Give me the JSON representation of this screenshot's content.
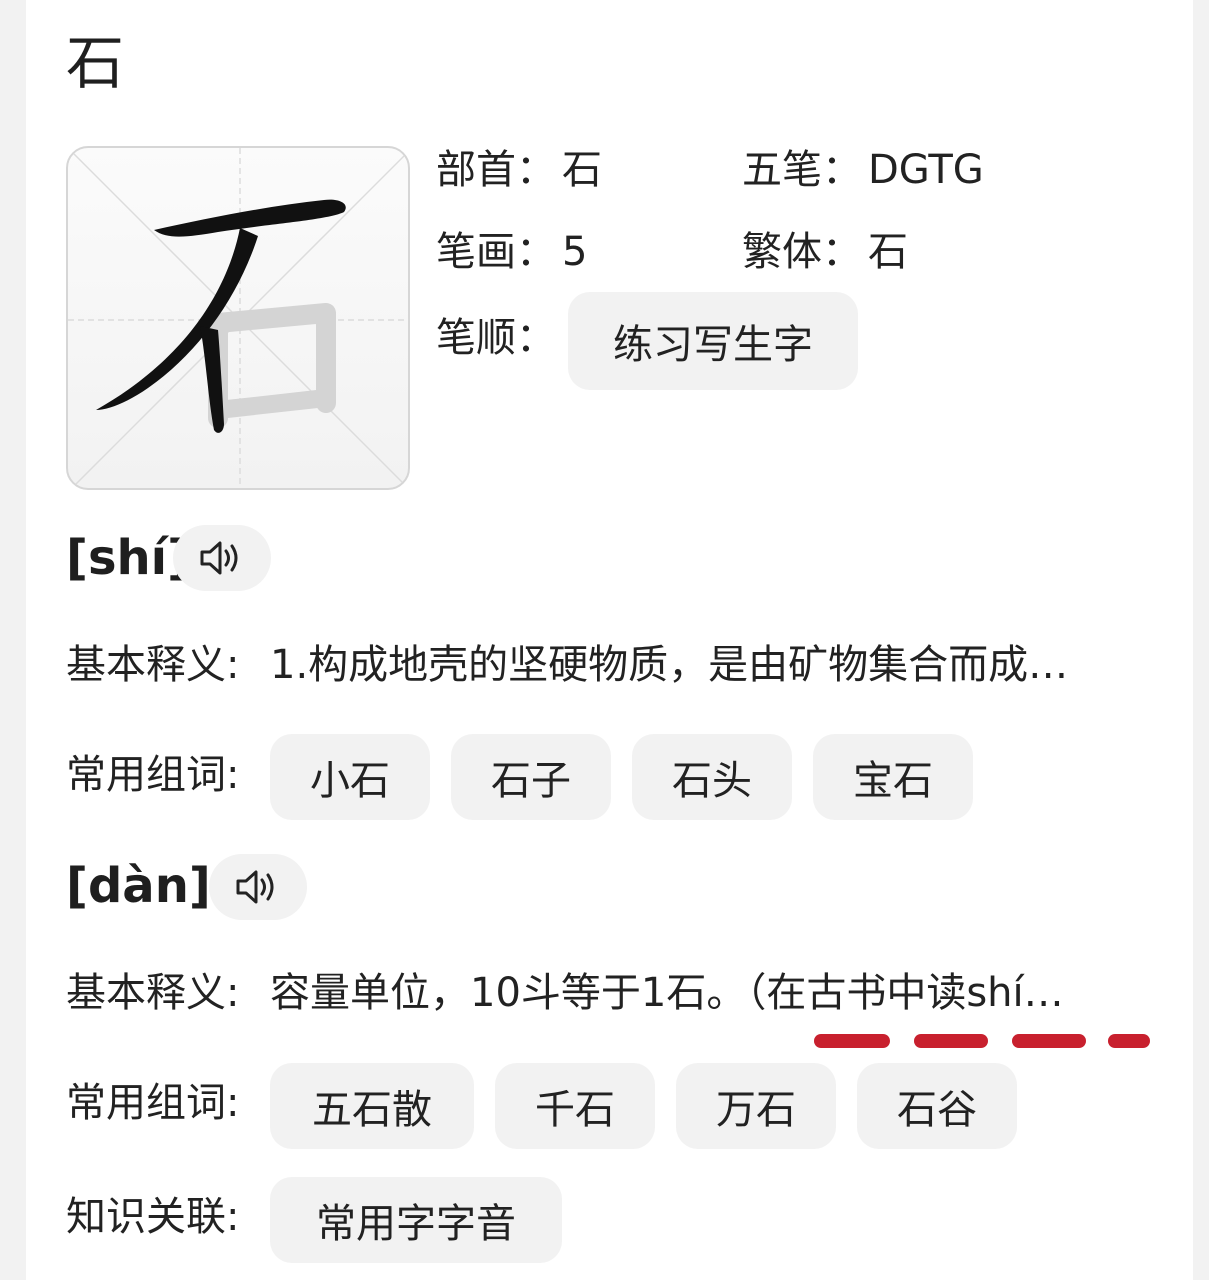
{
  "character": "石",
  "info": {
    "radical_label": "部首：",
    "radical_value": "石",
    "wubi_label": "五笔：",
    "wubi_value": "DGTG",
    "strokes_label": "笔画：",
    "strokes_value": "5",
    "traditional_label": "繁体：",
    "traditional_value": "石",
    "stroke_order_label": "笔顺：",
    "practice_button": "练习写生字"
  },
  "readings": [
    {
      "pinyin": "[shí]",
      "definition_label": "基本释义:",
      "definition": "1.构成地壳的坚硬物质，是由矿物集合而成…",
      "words_label": "常用组词:",
      "words": [
        "小石",
        "石子",
        "石头",
        "宝石"
      ]
    },
    {
      "pinyin": "[dàn]",
      "definition_label": "基本释义:",
      "definition": "容量单位，10斗等于1石。（在古书中读shí…",
      "words_label": "常用组词:",
      "words": [
        "五石散",
        "千石",
        "万石",
        "石谷"
      ]
    }
  ],
  "knowledge": {
    "label": "知识关联:",
    "tag": "常用字字音"
  },
  "icons": {
    "sound": "speaker-icon"
  },
  "colors": {
    "accent_dash": "#c8202e",
    "pill_bg": "#f2f2f2"
  }
}
